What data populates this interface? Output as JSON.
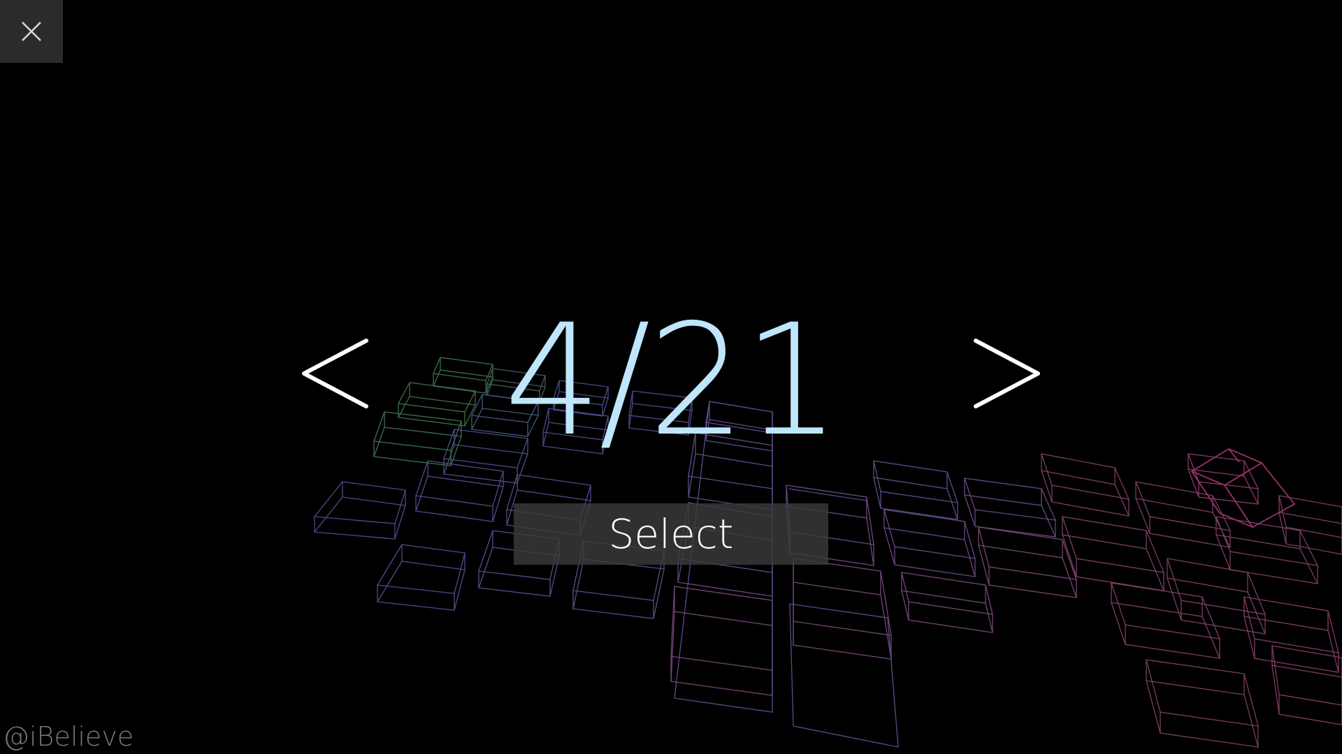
{
  "close_button": {
    "icon": "close-icon",
    "color": "#d8d8d8",
    "background": "#2b2b2b"
  },
  "level_selector": {
    "current": "4",
    "separator": "/",
    "total": "21",
    "display": "4/21",
    "text_color": "#bfe6fb",
    "prev_icon": "chevron-left-icon",
    "next_icon": "chevron-right-icon"
  },
  "select_button": {
    "label": "Select"
  },
  "watermark": {
    "text": "@iBelieve"
  },
  "background": {
    "color": "#000000",
    "description_colors": [
      "#4a7a4a",
      "#4b4b8a",
      "#5a4b8a",
      "#7a3f60",
      "#a0306a"
    ]
  }
}
